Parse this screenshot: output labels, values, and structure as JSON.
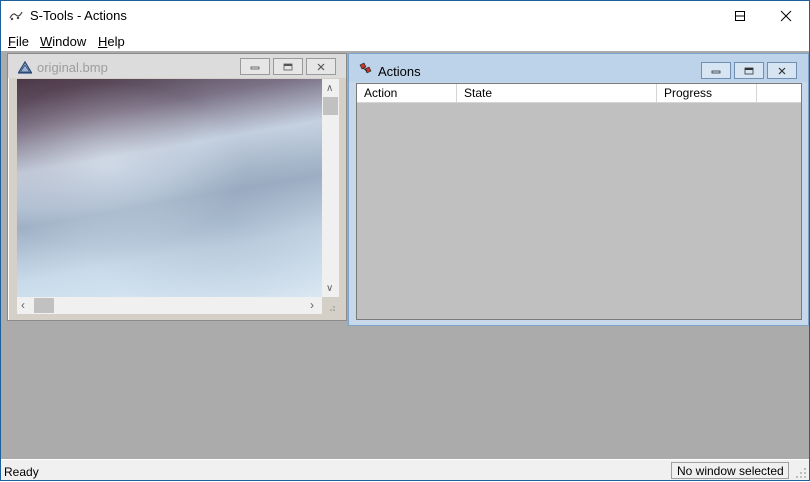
{
  "window": {
    "title": "S-Tools - Actions",
    "controls": {
      "minimize": "minimize",
      "maximize": "maximize",
      "close": "close"
    }
  },
  "menu": {
    "items": [
      {
        "label": "File",
        "accel": "F",
        "rest": "ile"
      },
      {
        "label": "Window",
        "accel": "W",
        "rest": "indow"
      },
      {
        "label": "Help",
        "accel": "H",
        "rest": "elp"
      }
    ]
  },
  "image_window": {
    "title": "original.bmp",
    "icon": "bitmap-icon"
  },
  "actions_window": {
    "title": "Actions",
    "icon": "actions-icon",
    "columns": [
      "Action",
      "State",
      "Progress"
    ]
  },
  "statusbar": {
    "left": "Ready",
    "right": "No window selected"
  },
  "colors": {
    "mdi_background": "#ababab",
    "active_title": "#bcd3ea",
    "inactive_title": "#dcdcdc"
  }
}
